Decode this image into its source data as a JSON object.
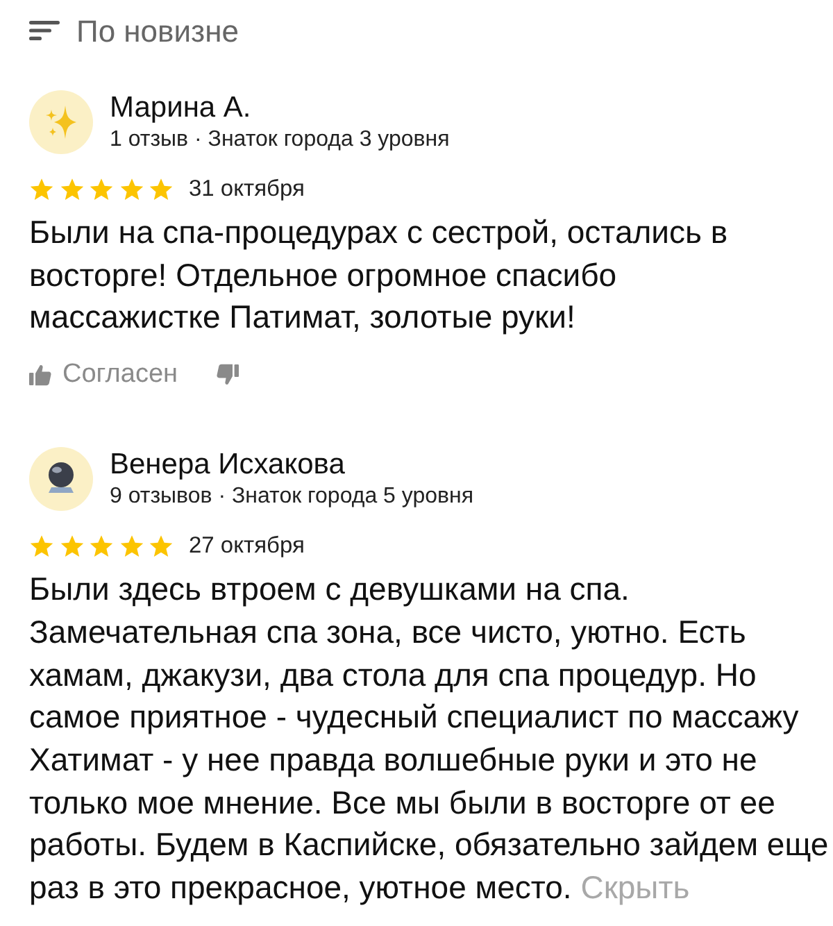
{
  "sort": {
    "label": "По новизне"
  },
  "reviews": [
    {
      "author": "Марина А.",
      "meta": "1 отзыв · Знаток города 3 уровня",
      "stars": 5,
      "date": "31 октября",
      "text": "Были на спа-процедурах с сестрой, остались в восторге! Отдельное огромное спасибо массажистке Патимат, золотые руки!",
      "reactions": {
        "agree_label": "Согласен"
      }
    },
    {
      "author": "Венера Исхакова",
      "meta": "9 отзывов · Знаток города 5 уровня",
      "stars": 5,
      "date": "27 октября",
      "text": "Были здесь втроем с девушками на спа. Замечательная спа зона, все чисто, уютно. Есть хамам, джакузи, два стола для спа процедур. Но самое приятное - чудесный специалист по массажу Хатимат - у нее правда волшебные руки и это не только мое мнение. Все мы были в восторге от ее работы. Будем в Каспийске, обязательно зайдем еще раз в это прекрасное, уютное место.",
      "collapse_link": "Скрыть"
    }
  ]
}
